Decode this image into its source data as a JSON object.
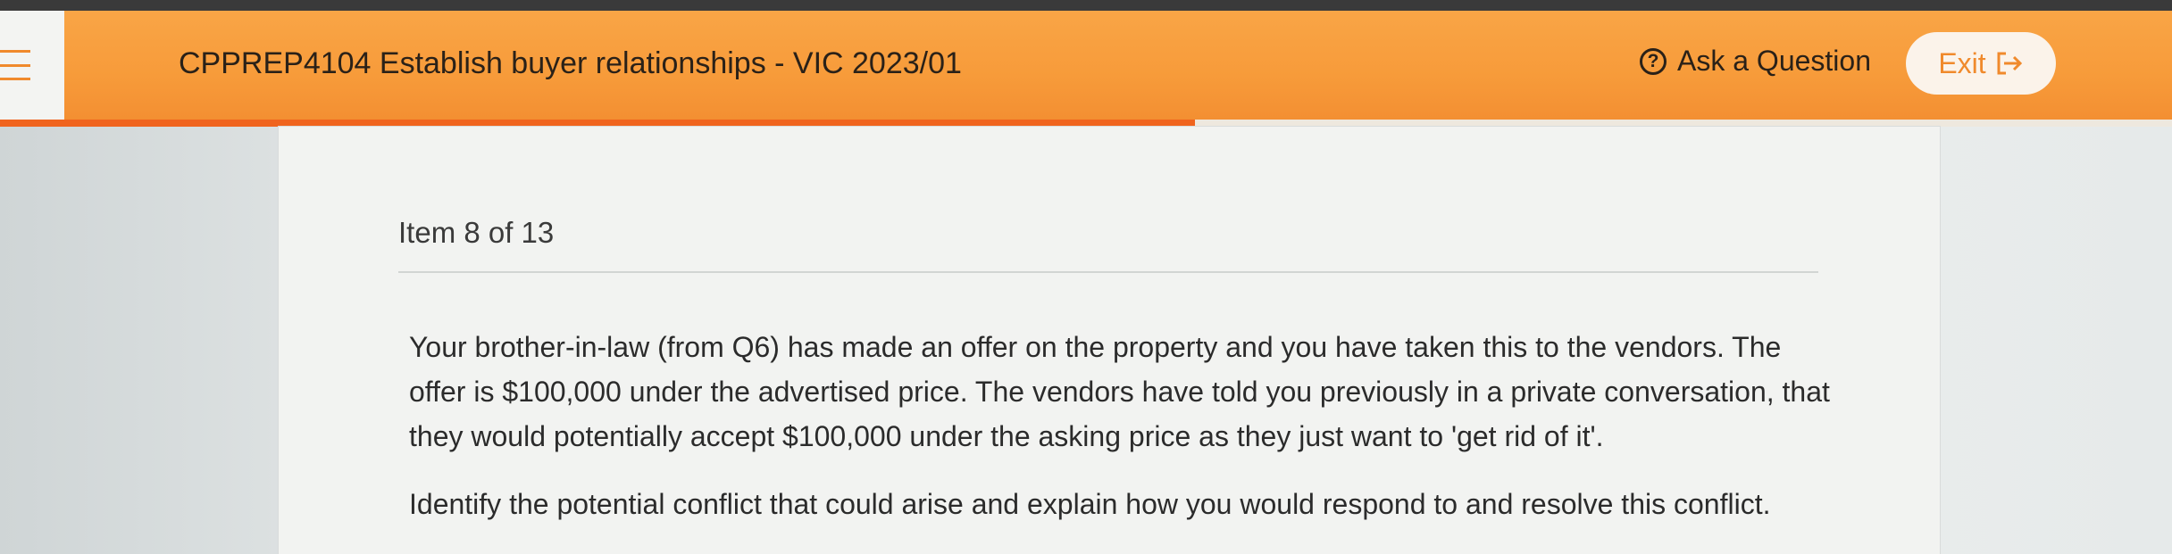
{
  "header": {
    "course_title": "CPPREP4104 Establish buyer relationships - VIC 2023/01",
    "ask_label": "Ask a Question",
    "ask_icon": "question-circle-icon",
    "exit_label": "Exit",
    "exit_icon": "sign-out-icon",
    "menu_icon": "hamburger-menu-icon"
  },
  "progress": {
    "fraction": 0.55
  },
  "colors": {
    "header_orange": "#f79b3a",
    "progress_fill": "#f0641e",
    "exit_text": "#f08a2c"
  },
  "item": {
    "counter": "Item 8 of 13",
    "question_lines": [
      "Your brother-in-law (from Q6) has made an offer on the property and you have taken this to the vendors. The",
      "offer is $100,000 under the advertised price. The vendors have told you previously in a private conversation, that",
      "they would potentially accept $100,000 under the asking price as they just want to 'get rid of it'."
    ],
    "instruction": "Identify the potential conflict that could arise and explain how you would respond to and resolve this conflict."
  }
}
